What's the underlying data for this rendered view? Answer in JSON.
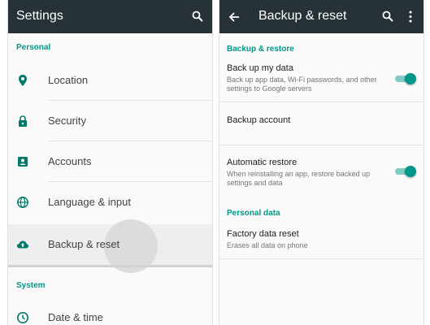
{
  "settings": {
    "title": "Settings",
    "section_personal": "Personal",
    "section_system": "System",
    "items": [
      {
        "label": "Location",
        "icon": "location-pin-icon"
      },
      {
        "label": "Security",
        "icon": "lock-icon"
      },
      {
        "label": "Accounts",
        "icon": "account-box-icon"
      },
      {
        "label": "Language & input",
        "icon": "globe-icon"
      },
      {
        "label": "Backup & reset",
        "icon": "cloud-upload-icon"
      },
      {
        "label": "Date & time",
        "icon": "clock-icon"
      }
    ],
    "selected_item": "Backup & reset"
  },
  "backup": {
    "title": "Backup & reset",
    "section_restore": "Backup & restore",
    "section_personal": "Personal data",
    "backup_my_data": {
      "title": "Back up my data",
      "summary": "Back up app data, Wi-Fi passwords, and other settings to Google servers",
      "enabled": true
    },
    "backup_account": {
      "title": "Backup account"
    },
    "automatic_restore": {
      "title": "Automatic restore",
      "summary": "When reinstalling an app, restore backed up settings and data",
      "enabled": true
    },
    "factory_reset": {
      "title": "Factory data reset",
      "summary": "Erases all data on phone"
    }
  },
  "colors": {
    "appbar": "#263238",
    "accent": "#009688",
    "accent_light": "#80cbc4",
    "icon": "#00796b",
    "text_primary": "#212121",
    "text_secondary": "#757575"
  }
}
